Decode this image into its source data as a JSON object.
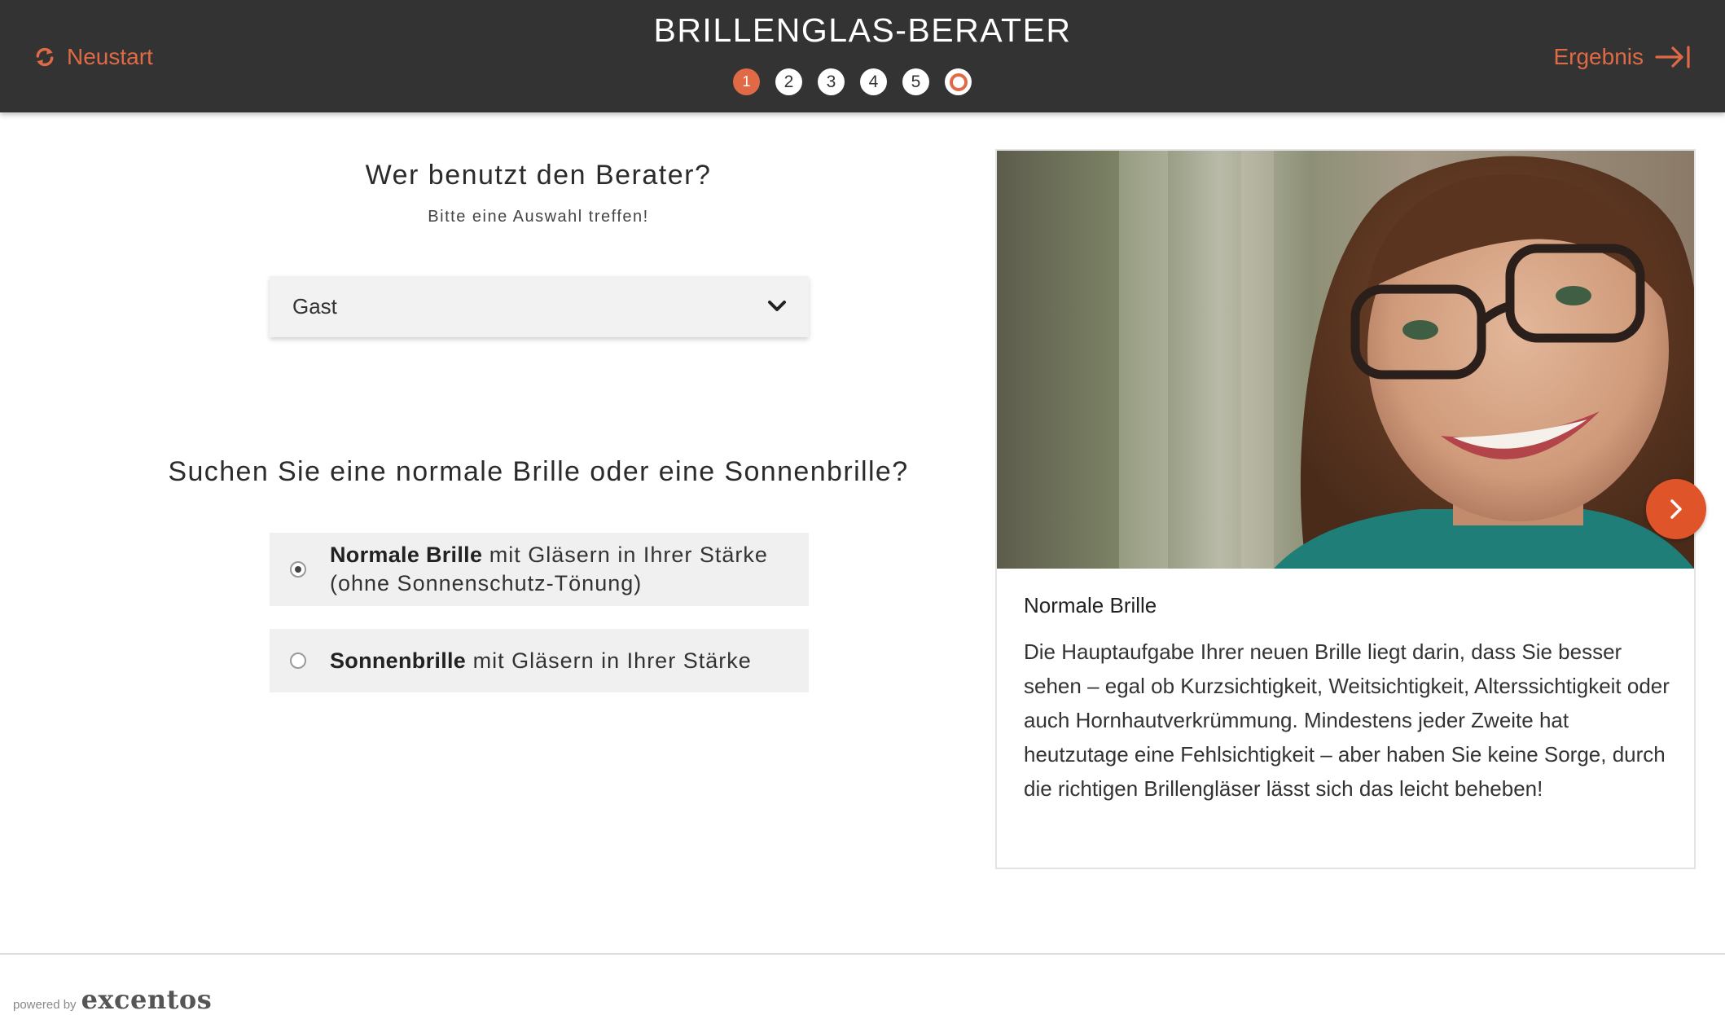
{
  "header": {
    "restart_label": "Neustart",
    "title": "BRILLENGLAS-BERATER",
    "result_label": "Ergebnis",
    "steps": [
      "1",
      "2",
      "3",
      "4",
      "5"
    ],
    "accent_color": "#e06a45",
    "bar_color": "#333333"
  },
  "question1": {
    "title": "Wer benutzt den Berater?",
    "subtitle": "Bitte eine Auswahl treffen!",
    "select_value": "Gast"
  },
  "question2": {
    "title": "Suchen Sie eine normale Brille oder eine Sonnenbrille?",
    "options": [
      {
        "bold": "Normale Brille",
        "rest": " mit Gläsern in Ihrer Stärke (ohne Sonnenschutz-Tönung)",
        "checked": true
      },
      {
        "bold": "Sonnenbrille",
        "rest": " mit Gläsern in Ihrer Stärke",
        "checked": false
      }
    ]
  },
  "info_card": {
    "title": "Normale Brille",
    "text": "Die Hauptaufgabe Ihrer neuen Brille liegt darin, dass Sie besser sehen – egal ob Kurzsichtigkeit, Weitsichtigkeit, Alterssichtigkeit oder auch Hornhautverkrümmung. Mindestens jeder Zweite hat heutzutage eine Fehlsichtigkeit – aber haben Sie keine Sorge, durch die richtigen Brillengläser lässt sich das leicht beheben!"
  },
  "footer": {
    "powered_by": "powered by",
    "logo_text": "excentos"
  }
}
